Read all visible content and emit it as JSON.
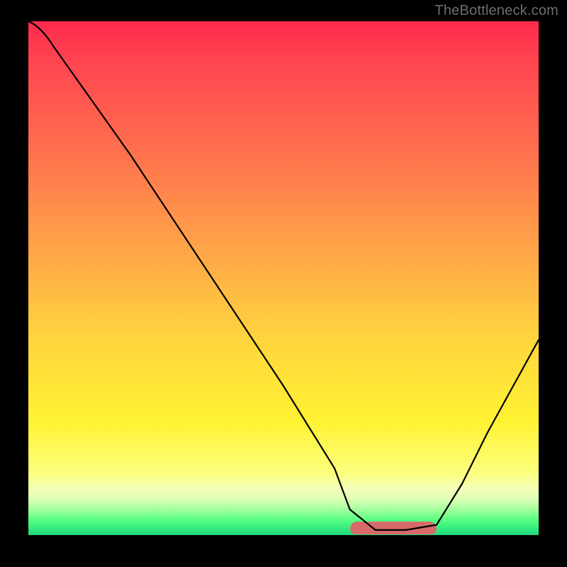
{
  "watermark": "TheBottleneck.com",
  "chart_data": {
    "type": "line",
    "title": "",
    "xlabel": "",
    "ylabel": "",
    "xlim": [
      0,
      100
    ],
    "ylim": [
      0,
      100
    ],
    "grid": false,
    "series": [
      {
        "name": "bottleneck-curve",
        "x": [
          0,
          5,
          10,
          20,
          30,
          40,
          50,
          60,
          63,
          68,
          74,
          80,
          85,
          90,
          95,
          100
        ],
        "values": [
          100,
          95,
          88,
          74,
          59,
          44,
          29,
          13,
          5,
          1,
          1,
          2,
          10,
          20,
          29,
          38
        ]
      }
    ],
    "highlight_segment": {
      "name": "optimal-range",
      "x_start": 63,
      "x_end": 80,
      "y": 1,
      "color": "#d86a6a"
    },
    "background_gradient": {
      "stops": [
        {
          "pos": 0,
          "color": "#ff2a4d"
        },
        {
          "pos": 45,
          "color": "#ffa648"
        },
        {
          "pos": 78,
          "color": "#fff233"
        },
        {
          "pos": 95,
          "color": "#a4ff9e"
        },
        {
          "pos": 100,
          "color": "#20d67a"
        }
      ]
    }
  }
}
